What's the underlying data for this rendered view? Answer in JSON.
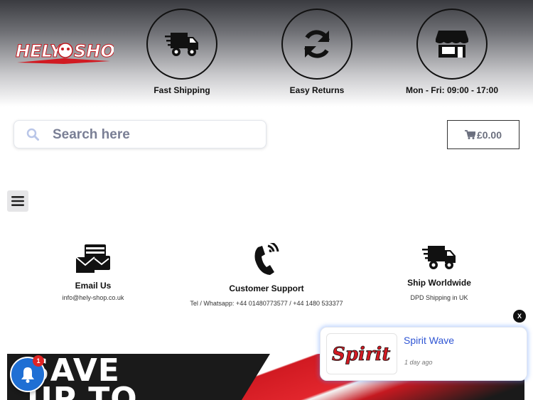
{
  "header": {
    "logo_text": "HELY SHOP",
    "features": [
      {
        "icon": "shipping-truck-icon",
        "label": "Fast Shipping"
      },
      {
        "icon": "sync-arrows-icon",
        "label": "Easy Returns"
      },
      {
        "icon": "store-front-icon",
        "label": "Mon - Fri: 09:00 - 17:00"
      }
    ]
  },
  "search": {
    "placeholder": "Search here",
    "value": "",
    "icon": "search-icon"
  },
  "cart": {
    "amount": "£0.00",
    "icon": "cart-icon"
  },
  "menu": {
    "icon": "hamburger-menu-icon"
  },
  "info": [
    {
      "icon": "email-envelopes-icon",
      "title": "Email Us",
      "text": "info@hely-shop.co.uk"
    },
    {
      "icon": "phone-ringing-icon",
      "title": "Customer Support",
      "text": "Tel / Whatsapp: +44 01480773577 / +44 1480 533377"
    },
    {
      "icon": "shipping-truck-icon",
      "title": "Ship Worldwide",
      "text": "DPD Shipping in UK"
    }
  ],
  "banner": {
    "line1": "SAVE",
    "line2": "UP TO"
  },
  "bell": {
    "count": "1",
    "icon": "bell-icon"
  },
  "notification": {
    "title": "Spirit Wave",
    "time": "1 day ago",
    "logo_text": "Spirit",
    "close": "X"
  },
  "colors": {
    "accent_blue": "#1f6fd4",
    "link_blue": "#2f55d4",
    "badge_red": "#e02424"
  }
}
